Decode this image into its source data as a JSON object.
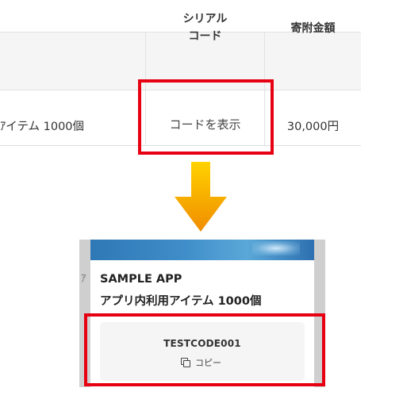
{
  "table": {
    "header_serial_line1": "シリアル",
    "header_serial_line2": "コード",
    "header_amount": "寄附金額",
    "row_item": "ｱイテム 1000個",
    "row_code_button": "コードを表示",
    "row_amount": "30,000円"
  },
  "panel": {
    "left_cut_char": "ｱ",
    "app_name": "SAMPLE APP",
    "item_name": "アプリ内利用アイテム 1000個",
    "code": "TESTCODE001",
    "copy_label": "コピー"
  },
  "colors": {
    "highlight": "#e60012",
    "arrow_top": "#ffd200",
    "arrow_bottom": "#f08c00"
  },
  "icons": {
    "arrow": "arrow-down-icon",
    "copy": "copy-icon"
  }
}
